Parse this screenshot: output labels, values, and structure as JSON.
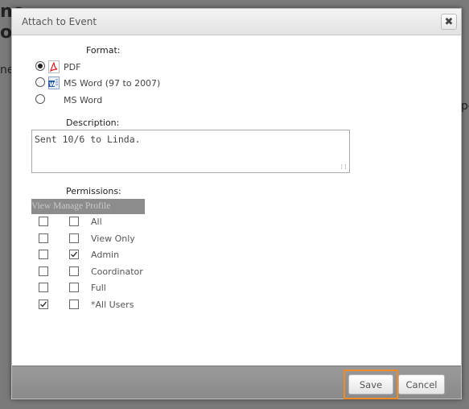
{
  "background": {
    "fragments": [
      "ne",
      "o",
      "ne",
      "po"
    ]
  },
  "dialog": {
    "title": "Attach to Event",
    "close_glyph": "✖",
    "format": {
      "label": "Format:",
      "options": [
        {
          "label": "PDF",
          "selected": true,
          "icon": "pdf-icon"
        },
        {
          "label": "MS Word (97 to 2007)",
          "selected": false,
          "icon": "word-icon"
        },
        {
          "label": "MS Word",
          "selected": false,
          "icon": ""
        }
      ]
    },
    "description": {
      "label": "Description:",
      "value": "Sent 10/6 to Linda."
    },
    "permissions": {
      "label": "Permissions:",
      "header": "View Manage Profile",
      "rows": [
        {
          "label": "All",
          "view": false,
          "manage": false
        },
        {
          "label": "View Only",
          "view": false,
          "manage": false
        },
        {
          "label": "Admin",
          "view": false,
          "manage": true
        },
        {
          "label": "Coordinator",
          "view": false,
          "manage": false
        },
        {
          "label": "Full",
          "view": false,
          "manage": false
        },
        {
          "label": "*All Users",
          "view": true,
          "manage": false
        }
      ]
    },
    "buttons": {
      "save": "Save",
      "cancel": "Cancel"
    },
    "colors": {
      "highlight": "#f08a24",
      "footer": "#8f8f8f"
    }
  }
}
